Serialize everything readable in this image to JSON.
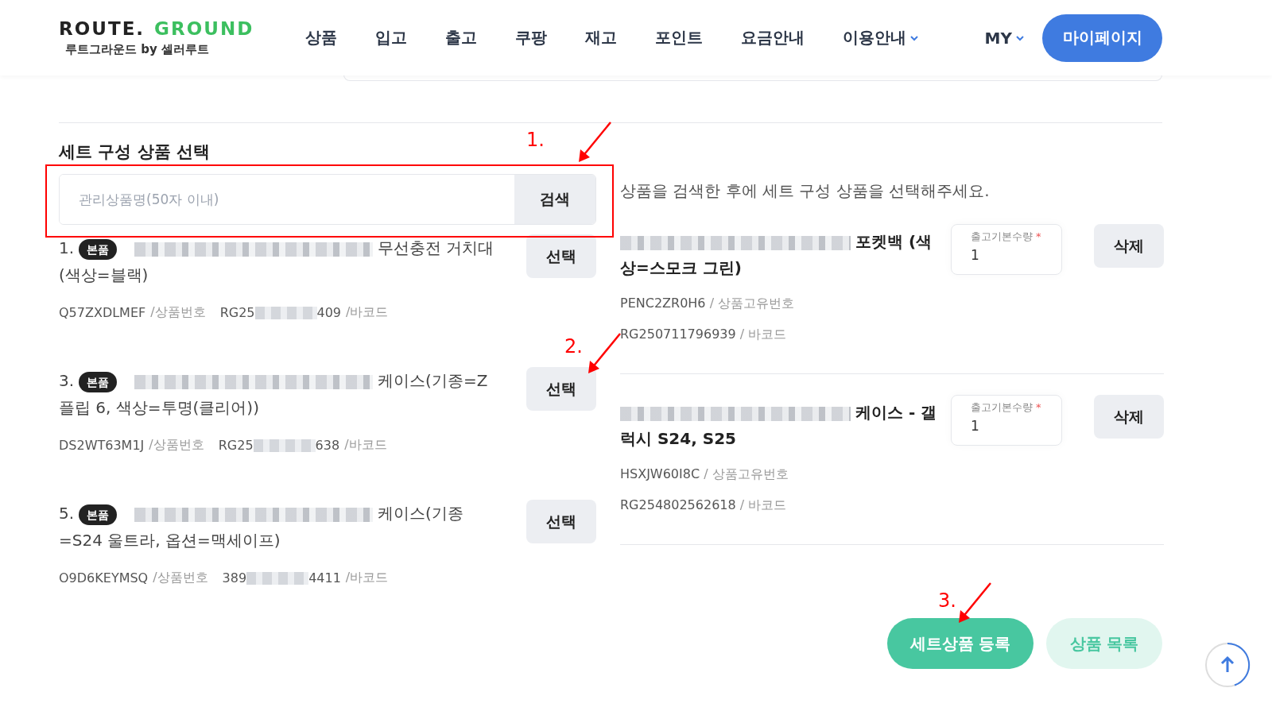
{
  "header": {
    "logo": {
      "left": "ROUTE.",
      "right": "GROUND",
      "tagline": "루트그라운드 by 셀러루트"
    },
    "nav": [
      {
        "label": "상품",
        "dropdown": false
      },
      {
        "label": "입고",
        "dropdown": false
      },
      {
        "label": "출고",
        "dropdown": false
      },
      {
        "label": "쿠팡",
        "dropdown": false
      },
      {
        "label": "재고",
        "dropdown": false
      },
      {
        "label": "포인트",
        "dropdown": false
      },
      {
        "label": "요금안내",
        "dropdown": false
      },
      {
        "label": "이용안내",
        "dropdown": true
      }
    ],
    "my": "MY",
    "mypage_button": "마이페이지"
  },
  "section": {
    "title": "세트 구성 상품 선택",
    "search": {
      "placeholder": "관리상품명(50자 이내)",
      "button": "검색"
    },
    "results": [
      {
        "number": "1.",
        "badge": "본품",
        "name": [
          {
            "kind": "blur"
          },
          {
            "kind": "text",
            "text": "무선충전 거치대(색상=블랙)"
          }
        ],
        "product_no": "Q57ZXDLMEF",
        "product_no_label": "/상품번호",
        "barcode_start": "RG25",
        "barcode_end": "409",
        "barcode_label": "/바코드",
        "button": "선택"
      },
      {
        "number": "3.",
        "badge": "본품",
        "name": [
          {
            "kind": "blur"
          },
          {
            "kind": "text",
            "text": "케이스(기종=Z 플립 6, 색상=투명(클리어))"
          }
        ],
        "product_no": "DS2WT63M1J",
        "product_no_label": "/상품번호",
        "barcode_start": "RG25",
        "barcode_end": "638",
        "barcode_label": "/바코드",
        "button": "선택"
      },
      {
        "number": "5.",
        "badge": "본품",
        "name": [
          {
            "kind": "blur"
          },
          {
            "kind": "text",
            "text": "케이스(기종=S24 울트라, 옵션=맥세이프)"
          }
        ],
        "product_no": "O9D6KEYMSQ",
        "product_no_label": "/상품번호",
        "barcode_start": "389",
        "barcode_end": "4411",
        "barcode_label": "/바코드",
        "button": "선택"
      }
    ],
    "hint": "상품을 검색한 후에 세트 구성 상품을 선택해주세요.",
    "selected": [
      {
        "name": [
          {
            "kind": "blur"
          },
          {
            "kind": "text",
            "text": "포켓백 (색상=스모크 그린)"
          }
        ],
        "product_id": "PENC2ZR0H6",
        "product_id_label": "/ 상품고유번호",
        "barcode": "RG250711796939",
        "barcode_label": "/ 바코드",
        "qty_label": "출고기본수량",
        "qty_required": true,
        "required_mark": "*",
        "qty": "1",
        "button": "삭제"
      },
      {
        "name": [
          {
            "kind": "blur"
          },
          {
            "kind": "text",
            "text": "케이스 - 갤럭시 S24, S25"
          }
        ],
        "product_id": "HSXJW60I8C",
        "product_id_label": "/ 상품고유번호",
        "barcode": "RG254802562618",
        "barcode_label": "/ 바코드",
        "qty_label": "출고기본수량",
        "qty_required": true,
        "required_mark": "*",
        "qty": "1",
        "button": "삭제"
      }
    ]
  },
  "actions": {
    "primary": "세트상품 등록",
    "secondary": "상품 목록"
  },
  "annotations": [
    {
      "label": "1."
    },
    {
      "label": "2."
    },
    {
      "label": "3."
    }
  ]
}
